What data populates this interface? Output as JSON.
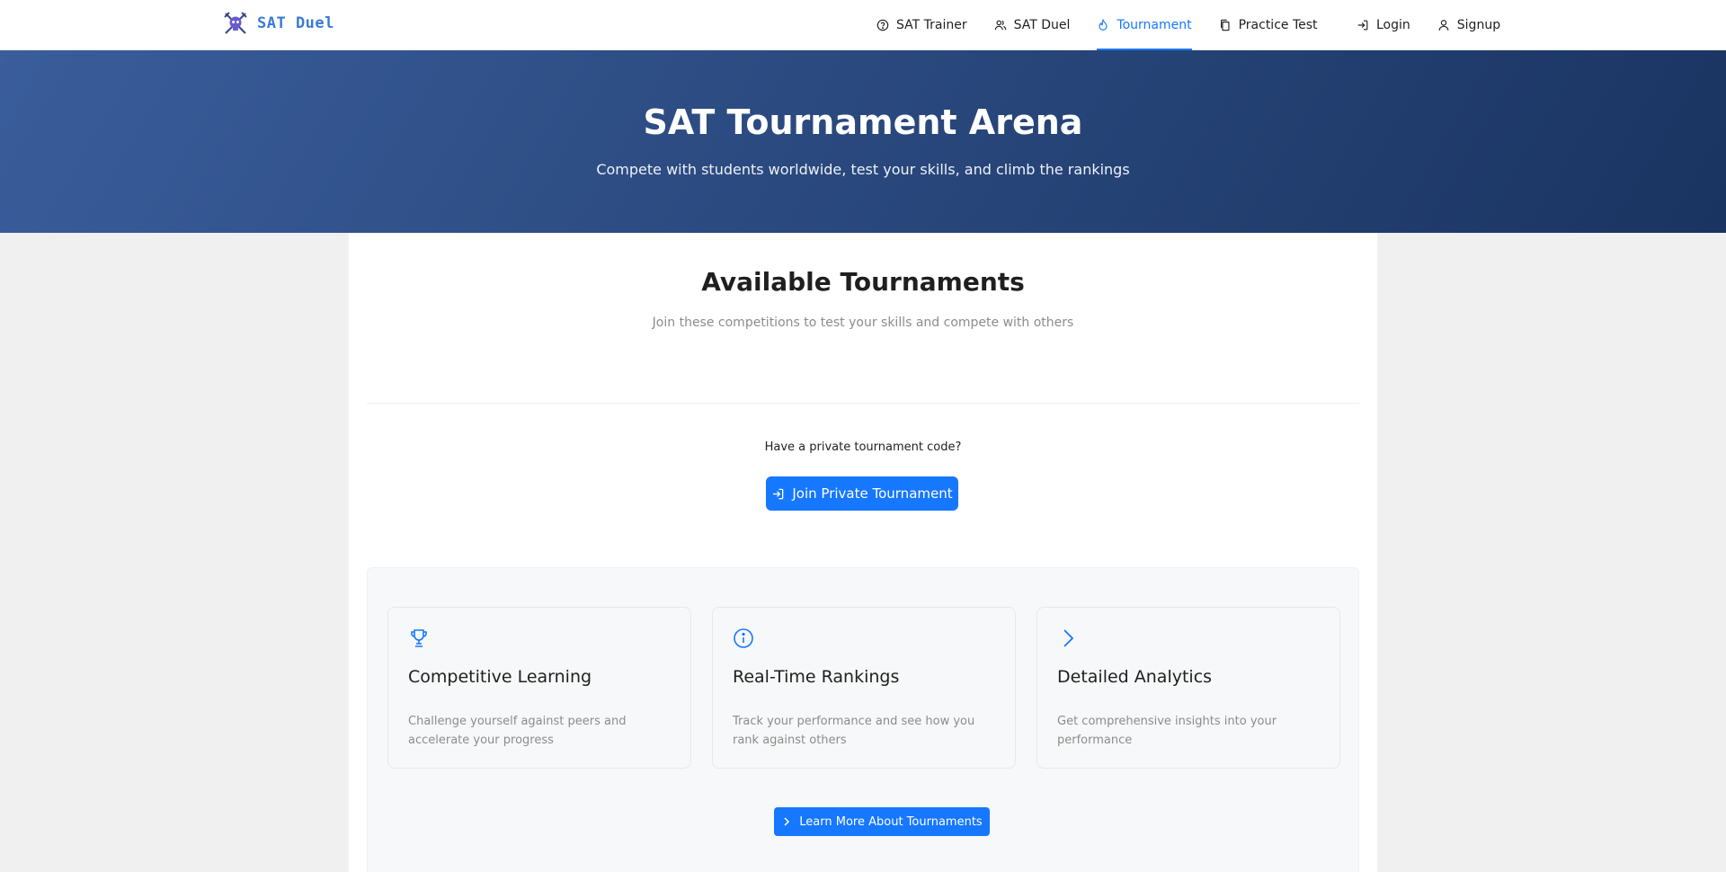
{
  "brand": {
    "name": "SAT Duel",
    "logo_icon": "crossed-swords-skull-icon"
  },
  "nav": {
    "items": [
      {
        "label": "SAT Trainer",
        "icon": "question-circle-icon"
      },
      {
        "label": "SAT Duel",
        "icon": "users-icon"
      },
      {
        "label": "Tournament",
        "icon": "fire-icon",
        "active": true
      },
      {
        "label": "Practice Test",
        "icon": "copy-icon"
      }
    ],
    "auth": [
      {
        "label": "Login",
        "icon": "login-icon"
      },
      {
        "label": "Signup",
        "icon": "user-icon"
      }
    ]
  },
  "hero": {
    "title": "SAT Tournament Arena",
    "subtitle": "Compete with students worldwide, test your skills, and climb the rankings"
  },
  "tournaments": {
    "title": "Available Tournaments",
    "subtitle": "Join these competitions to test your skills and compete with others",
    "private_prompt": "Have a private tournament code?",
    "join_button": "Join Private Tournament"
  },
  "features": [
    {
      "title": "Competitive Learning",
      "description": "Challenge yourself against peers and accelerate your progress",
      "icon": "trophy-icon"
    },
    {
      "title": "Real-Time Rankings",
      "description": "Track your performance and see how you rank against others",
      "icon": "info-circle-icon"
    },
    {
      "title": "Detailed Analytics",
      "description": "Get comprehensive insights into your performance",
      "icon": "chevron-right-icon"
    }
  ],
  "learn_more_button": "Learn More About Tournaments",
  "colors": {
    "accent": "#1677ff",
    "hero_start": "#3a5d9b",
    "hero_end": "#1a3461",
    "brand": "#3a7bd5"
  }
}
